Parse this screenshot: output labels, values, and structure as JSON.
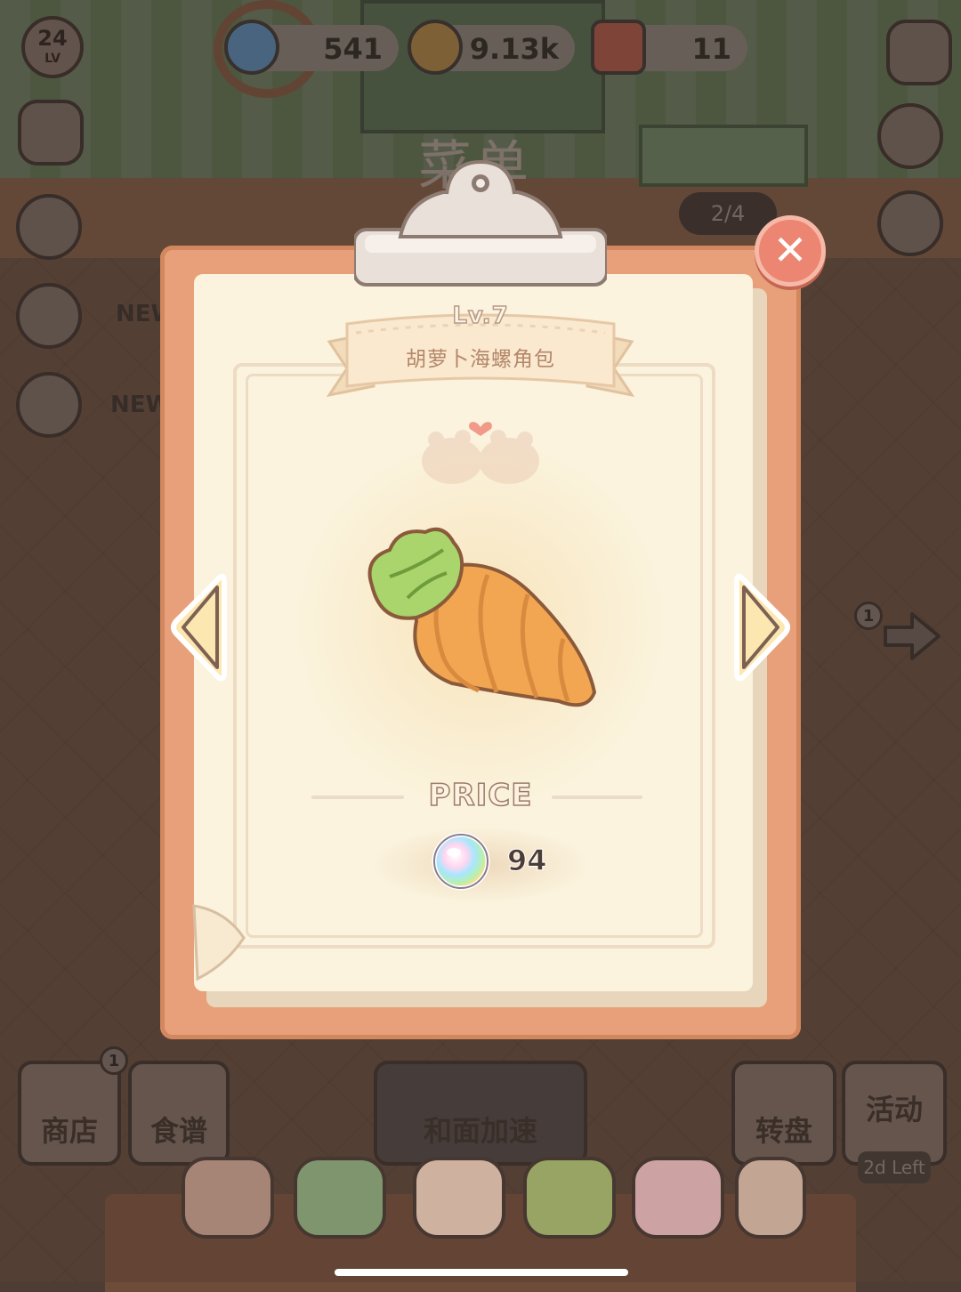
{
  "hud": {
    "level": "24",
    "level_label": "LV",
    "gems": "541",
    "coins": "9.13k",
    "tickets": "11"
  },
  "side_tags": {
    "new_1": "NEW",
    "new_2": "NEW"
  },
  "background": {
    "menu_title": "菜单",
    "progress": "2/4",
    "next_badge": "1"
  },
  "modal": {
    "level": "Lv.7",
    "dish_name": "胡萝卜海螺角包",
    "price_label": "PRICE",
    "price_value": "94",
    "close_symbol": "✕"
  },
  "bottom_bar": {
    "shop": "商店",
    "shop_badge": "1",
    "recipes": "食谱",
    "dough_speedup": "和面加速",
    "wheel": "转盘",
    "event": "活动",
    "event_timer": "2d Left"
  },
  "colors": {
    "board": "#e8a07a",
    "paper": "#fbf3dd",
    "close": "#ec8672",
    "arrow_fill": "#fde7b0"
  }
}
